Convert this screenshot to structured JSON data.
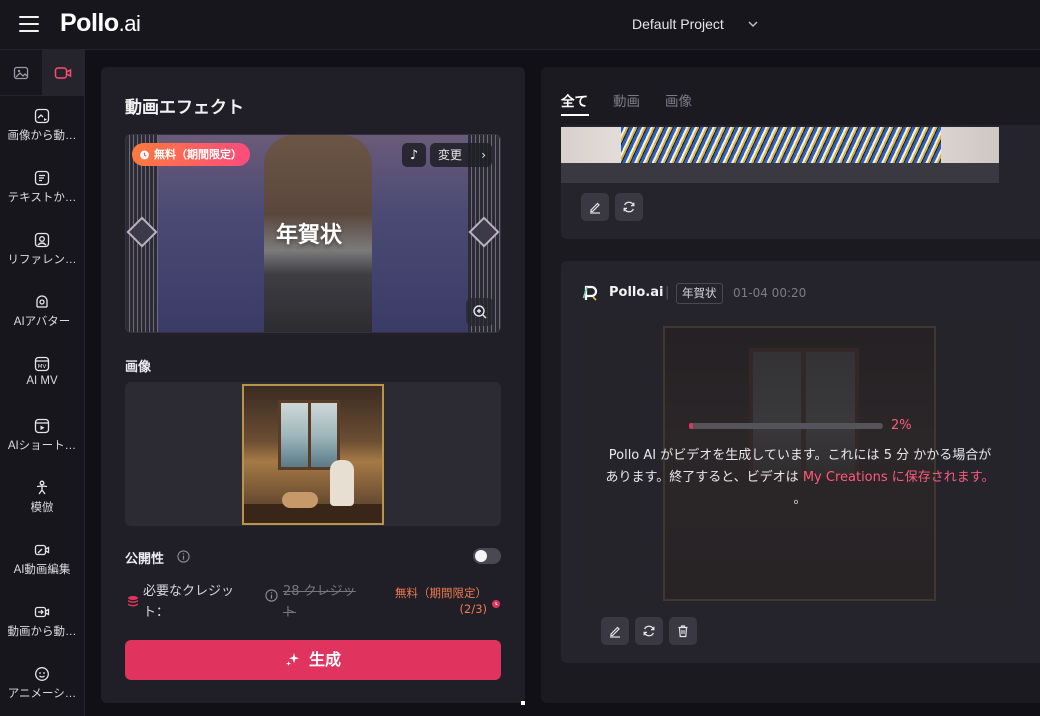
{
  "topbar": {
    "logo_main": "Pollo",
    "logo_suffix": ".ai",
    "project": "Default Project"
  },
  "leftnav": {
    "tabs": [
      {
        "name": "image-tab",
        "icon": "image-icon"
      },
      {
        "name": "video-tab",
        "icon": "video-icon",
        "active": true
      }
    ],
    "items": [
      {
        "label": "画像から動…",
        "icon": "image-to-video-icon"
      },
      {
        "label": "テキストか…",
        "icon": "text-to-video-icon"
      },
      {
        "label": "リファレン…",
        "icon": "reference-icon"
      },
      {
        "label": "AIアバター",
        "icon": "avatar-icon"
      },
      {
        "label": "AI MV",
        "icon": "mv-icon"
      },
      {
        "label": "AIショート…",
        "icon": "short-video-icon"
      },
      {
        "label": "模倣",
        "icon": "mimic-icon"
      },
      {
        "label": "AI動画編集",
        "icon": "video-edit-icon"
      },
      {
        "label": "動画から動…",
        "icon": "video-to-video-icon"
      },
      {
        "label": "アニメーシ…",
        "icon": "animation-icon"
      }
    ]
  },
  "panel": {
    "title": "動画エフェクト",
    "effect": {
      "badge": "無料（期間限定）",
      "change": "変更",
      "name": "年賀状"
    },
    "image_label": "画像",
    "public_label": "公開性",
    "public_on": false,
    "credits": {
      "label": "必要なクレジット：",
      "old": "28 クレジット",
      "free": "無料（期間限定）(2/3)"
    },
    "generate": "生成"
  },
  "results": {
    "tabs": [
      "全て",
      "動画",
      "画像"
    ],
    "active_tab": "全て",
    "card": {
      "brand": "Pollo.ai",
      "separator": "|",
      "tag": "年賀状",
      "time": "01-04 00:20",
      "progress": 2,
      "progress_label": "2%",
      "message_part1": "Pollo AI がビデオを生成しています。これには 5 分 かかる場合があります。終了すると、ビデオは ",
      "message_link": "My Creations に保存されます。",
      "message_end": " 。"
    }
  },
  "colors": {
    "accent": "#e0335e",
    "badge_gradient_start": "#ff7a3d",
    "badge_gradient_end": "#ff4c7d",
    "free_text": "#f07a52",
    "background": "#111016",
    "panel": "#201f27"
  }
}
